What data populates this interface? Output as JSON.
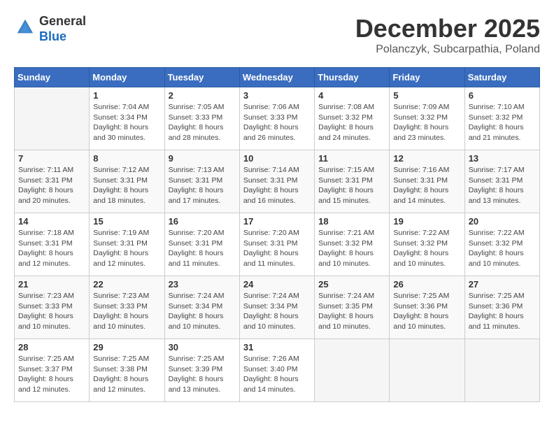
{
  "header": {
    "logo_line1": "General",
    "logo_line2": "Blue",
    "month": "December 2025",
    "location": "Polanczyk, Subcarpathia, Poland"
  },
  "days_of_week": [
    "Sunday",
    "Monday",
    "Tuesday",
    "Wednesday",
    "Thursday",
    "Friday",
    "Saturday"
  ],
  "weeks": [
    [
      {
        "day": "",
        "info": ""
      },
      {
        "day": "1",
        "info": "Sunrise: 7:04 AM\nSunset: 3:34 PM\nDaylight: 8 hours\nand 30 minutes."
      },
      {
        "day": "2",
        "info": "Sunrise: 7:05 AM\nSunset: 3:33 PM\nDaylight: 8 hours\nand 28 minutes."
      },
      {
        "day": "3",
        "info": "Sunrise: 7:06 AM\nSunset: 3:33 PM\nDaylight: 8 hours\nand 26 minutes."
      },
      {
        "day": "4",
        "info": "Sunrise: 7:08 AM\nSunset: 3:32 PM\nDaylight: 8 hours\nand 24 minutes."
      },
      {
        "day": "5",
        "info": "Sunrise: 7:09 AM\nSunset: 3:32 PM\nDaylight: 8 hours\nand 23 minutes."
      },
      {
        "day": "6",
        "info": "Sunrise: 7:10 AM\nSunset: 3:32 PM\nDaylight: 8 hours\nand 21 minutes."
      }
    ],
    [
      {
        "day": "7",
        "info": "Sunrise: 7:11 AM\nSunset: 3:31 PM\nDaylight: 8 hours\nand 20 minutes."
      },
      {
        "day": "8",
        "info": "Sunrise: 7:12 AM\nSunset: 3:31 PM\nDaylight: 8 hours\nand 18 minutes."
      },
      {
        "day": "9",
        "info": "Sunrise: 7:13 AM\nSunset: 3:31 PM\nDaylight: 8 hours\nand 17 minutes."
      },
      {
        "day": "10",
        "info": "Sunrise: 7:14 AM\nSunset: 3:31 PM\nDaylight: 8 hours\nand 16 minutes."
      },
      {
        "day": "11",
        "info": "Sunrise: 7:15 AM\nSunset: 3:31 PM\nDaylight: 8 hours\nand 15 minutes."
      },
      {
        "day": "12",
        "info": "Sunrise: 7:16 AM\nSunset: 3:31 PM\nDaylight: 8 hours\nand 14 minutes."
      },
      {
        "day": "13",
        "info": "Sunrise: 7:17 AM\nSunset: 3:31 PM\nDaylight: 8 hours\nand 13 minutes."
      }
    ],
    [
      {
        "day": "14",
        "info": "Sunrise: 7:18 AM\nSunset: 3:31 PM\nDaylight: 8 hours\nand 12 minutes."
      },
      {
        "day": "15",
        "info": "Sunrise: 7:19 AM\nSunset: 3:31 PM\nDaylight: 8 hours\nand 12 minutes."
      },
      {
        "day": "16",
        "info": "Sunrise: 7:20 AM\nSunset: 3:31 PM\nDaylight: 8 hours\nand 11 minutes."
      },
      {
        "day": "17",
        "info": "Sunrise: 7:20 AM\nSunset: 3:31 PM\nDaylight: 8 hours\nand 11 minutes."
      },
      {
        "day": "18",
        "info": "Sunrise: 7:21 AM\nSunset: 3:32 PM\nDaylight: 8 hours\nand 10 minutes."
      },
      {
        "day": "19",
        "info": "Sunrise: 7:22 AM\nSunset: 3:32 PM\nDaylight: 8 hours\nand 10 minutes."
      },
      {
        "day": "20",
        "info": "Sunrise: 7:22 AM\nSunset: 3:32 PM\nDaylight: 8 hours\nand 10 minutes."
      }
    ],
    [
      {
        "day": "21",
        "info": "Sunrise: 7:23 AM\nSunset: 3:33 PM\nDaylight: 8 hours\nand 10 minutes."
      },
      {
        "day": "22",
        "info": "Sunrise: 7:23 AM\nSunset: 3:33 PM\nDaylight: 8 hours\nand 10 minutes."
      },
      {
        "day": "23",
        "info": "Sunrise: 7:24 AM\nSunset: 3:34 PM\nDaylight: 8 hours\nand 10 minutes."
      },
      {
        "day": "24",
        "info": "Sunrise: 7:24 AM\nSunset: 3:34 PM\nDaylight: 8 hours\nand 10 minutes."
      },
      {
        "day": "25",
        "info": "Sunrise: 7:24 AM\nSunset: 3:35 PM\nDaylight: 8 hours\nand 10 minutes."
      },
      {
        "day": "26",
        "info": "Sunrise: 7:25 AM\nSunset: 3:36 PM\nDaylight: 8 hours\nand 10 minutes."
      },
      {
        "day": "27",
        "info": "Sunrise: 7:25 AM\nSunset: 3:36 PM\nDaylight: 8 hours\nand 11 minutes."
      }
    ],
    [
      {
        "day": "28",
        "info": "Sunrise: 7:25 AM\nSunset: 3:37 PM\nDaylight: 8 hours\nand 12 minutes."
      },
      {
        "day": "29",
        "info": "Sunrise: 7:25 AM\nSunset: 3:38 PM\nDaylight: 8 hours\nand 12 minutes."
      },
      {
        "day": "30",
        "info": "Sunrise: 7:25 AM\nSunset: 3:39 PM\nDaylight: 8 hours\nand 13 minutes."
      },
      {
        "day": "31",
        "info": "Sunrise: 7:26 AM\nSunset: 3:40 PM\nDaylight: 8 hours\nand 14 minutes."
      },
      {
        "day": "",
        "info": ""
      },
      {
        "day": "",
        "info": ""
      },
      {
        "day": "",
        "info": ""
      }
    ]
  ]
}
